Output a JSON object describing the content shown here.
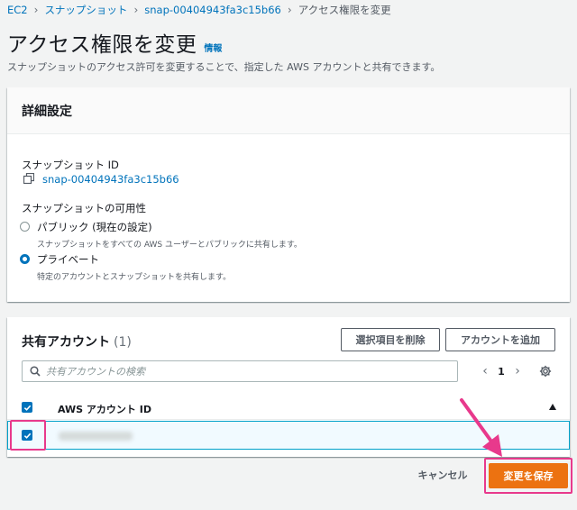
{
  "breadcrumb": {
    "items": [
      "EC2",
      "スナップショット",
      "snap-00404943fa3c15b66",
      "アクセス権限を変更"
    ]
  },
  "header": {
    "title": "アクセス権限を変更",
    "info_label": "情報",
    "description": "スナップショットのアクセス許可を変更することで、指定した AWS アカウントと共有できます。"
  },
  "details": {
    "heading": "詳細設定",
    "snapshot_id_label": "スナップショット ID",
    "snapshot_id_value": "snap-00404943fa3c15b66",
    "availability_label": "スナップショットの可用性",
    "options": [
      {
        "label": "パブリック (現在の設定)",
        "description": "スナップショットをすべての AWS ユーザーとパブリックに共有します。",
        "selected": false
      },
      {
        "label": "プライベート",
        "description": "特定のアカウントとスナップショットを共有します。",
        "selected": true
      }
    ]
  },
  "shared_accounts": {
    "heading": "共有アカウント",
    "count": "(1)",
    "remove_button": "選択項目を削除",
    "add_button": "アカウントを追加",
    "search_placeholder": "共有アカウントの検索",
    "page_number": "1",
    "column_header": "AWS アカウント ID",
    "rows": [
      {
        "checked": true
      }
    ]
  },
  "footer": {
    "cancel_label": "キャンセル",
    "save_label": "変更を保存"
  },
  "colors": {
    "accent": "#0073bb",
    "primary_button": "#ec7211",
    "annotation": "#e8398c"
  },
  "icons": [
    "chevron-right-icon",
    "copy-icon",
    "search-icon",
    "chevron-left-icon",
    "gear-icon",
    "sort-ascending-icon",
    "checkbox-checked-icon",
    "annotation-arrow-icon"
  ]
}
